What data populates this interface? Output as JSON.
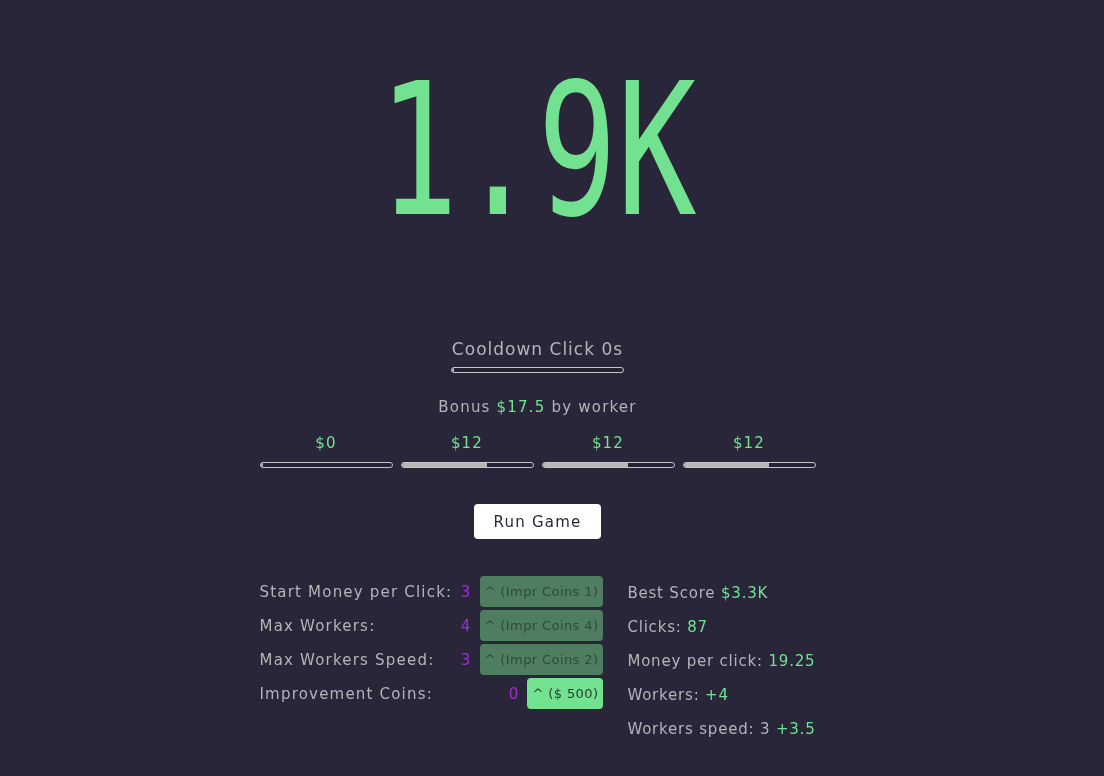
{
  "score": "1.9K",
  "cooldown": {
    "label": "Cooldown Click 0s",
    "level": 0
  },
  "bonus": {
    "prefix": "Bonus",
    "amount": "$17.5",
    "suffix": "by worker"
  },
  "workers": [
    {
      "earnings": "$0",
      "level": 0
    },
    {
      "earnings": "$12",
      "level": 0.65
    },
    {
      "earnings": "$12",
      "level": 0.65
    },
    {
      "earnings": "$12",
      "level": 0.65
    }
  ],
  "run_button": "Run Game",
  "upgrades": [
    {
      "label": "Start Money per Click:",
      "value": "3",
      "button": "^ (Impr Coins 1)",
      "disabled": true
    },
    {
      "label": "Max Workers:",
      "value": "4",
      "button": "^ (Impr Coins 4)",
      "disabled": true
    },
    {
      "label": "Max Workers Speed:",
      "value": "3",
      "button": "^ (Impr Coins 2)",
      "disabled": true
    },
    {
      "label": "Improvement Coins:",
      "value": "0",
      "button": "^ ($ 500)",
      "disabled": false
    }
  ],
  "stats": [
    {
      "label": "Best Score",
      "value": "$3.3K"
    },
    {
      "label": "Clicks:",
      "value": "87"
    },
    {
      "label": "Money per click:",
      "value": "19.25"
    },
    {
      "label": "Workers:",
      "value": "+4"
    },
    {
      "label": "Workers speed: 3",
      "value": "+3.5"
    }
  ]
}
